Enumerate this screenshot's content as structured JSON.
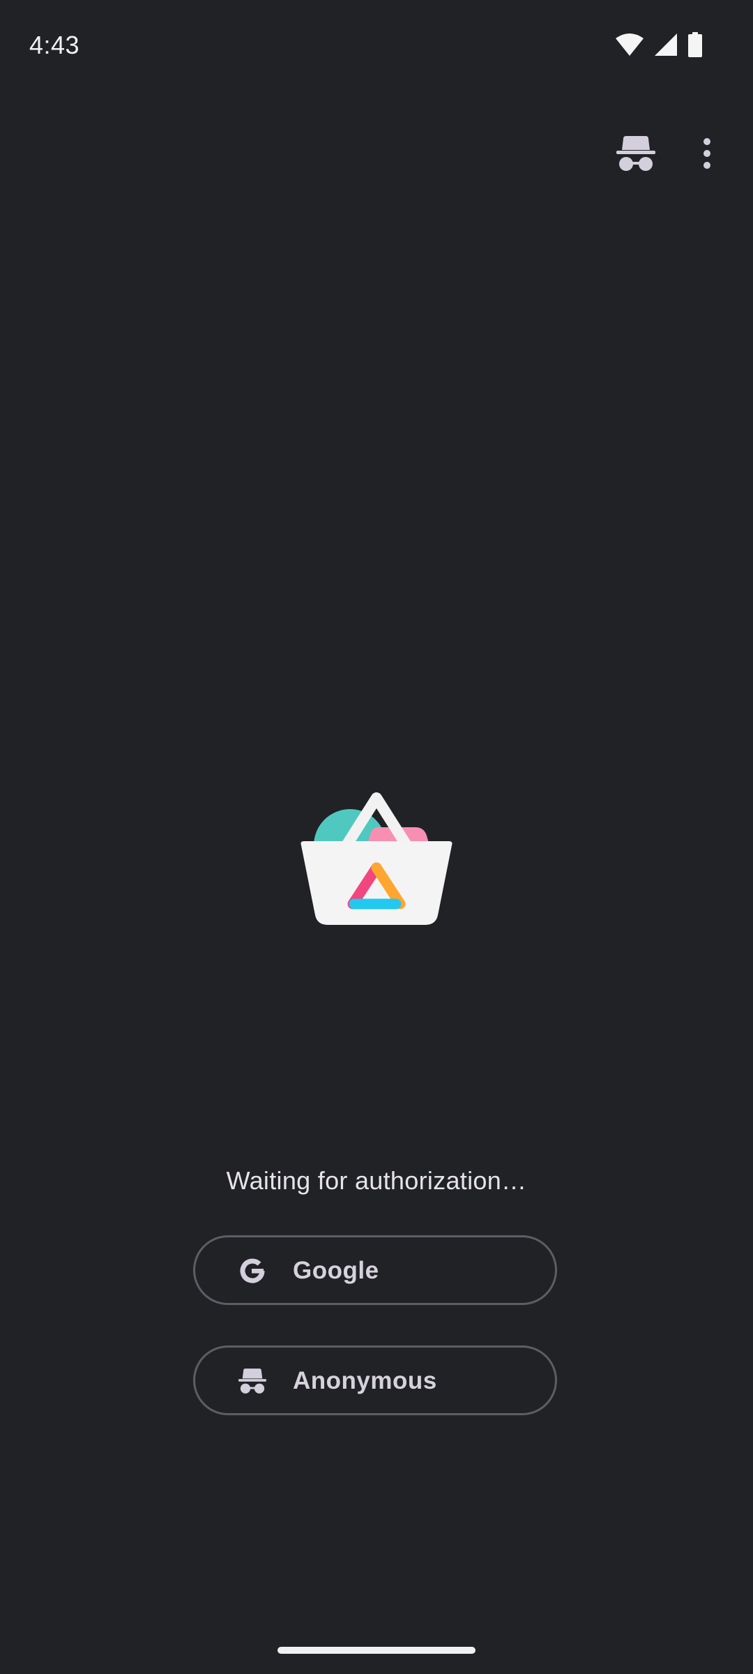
{
  "status_bar": {
    "time": "4:43",
    "icons": [
      "wifi-icon",
      "cellular-signal-icon",
      "battery-icon"
    ]
  },
  "top_actions": {
    "icons": [
      "incognito-icon",
      "more-vert-icon"
    ]
  },
  "logo": {
    "icon": "aurora-store-logo"
  },
  "auth": {
    "status_text": "Waiting for authorization…",
    "google_label": "Google",
    "anonymous_label": "Anonymous"
  },
  "colors": {
    "background": "#212226",
    "text": "#e6e3ea",
    "button_border": "#5f5d64",
    "icon_tint": "#d4cfdc",
    "logo_teal": "#4fc9bf",
    "logo_pink": "#f78fb3",
    "logo_magenta": "#f2467f",
    "logo_orange": "#ffa631",
    "logo_cyan": "#22c8f0"
  }
}
